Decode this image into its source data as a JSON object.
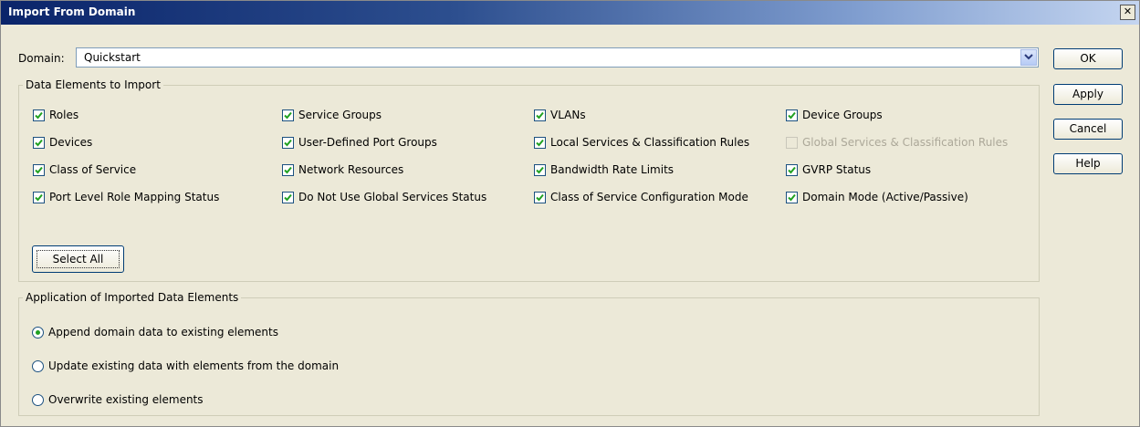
{
  "title": "Import From Domain",
  "close_glyph": "✕",
  "domain": {
    "label": "Domain:",
    "value": "Quickstart"
  },
  "buttons": {
    "ok": "OK",
    "apply": "Apply",
    "cancel": "Cancel",
    "help": "Help"
  },
  "data_elements": {
    "title": "Data Elements to Import",
    "items": [
      {
        "label": "Roles",
        "checked": true,
        "enabled": true
      },
      {
        "label": "Service Groups",
        "checked": true,
        "enabled": true
      },
      {
        "label": "VLANs",
        "checked": true,
        "enabled": true
      },
      {
        "label": "Device Groups",
        "checked": true,
        "enabled": true
      },
      {
        "label": "Devices",
        "checked": true,
        "enabled": true
      },
      {
        "label": "User-Defined Port Groups",
        "checked": true,
        "enabled": true
      },
      {
        "label": "Local Services & Classification Rules",
        "checked": true,
        "enabled": true
      },
      {
        "label": "Global Services & Classification Rules",
        "checked": false,
        "enabled": false
      },
      {
        "label": "Class of Service",
        "checked": true,
        "enabled": true
      },
      {
        "label": "Network Resources",
        "checked": true,
        "enabled": true
      },
      {
        "label": "Bandwidth Rate Limits",
        "checked": true,
        "enabled": true
      },
      {
        "label": "GVRP Status",
        "checked": true,
        "enabled": true
      },
      {
        "label": "Port Level Role Mapping Status",
        "checked": true,
        "enabled": true
      },
      {
        "label": "Do Not Use Global Services Status",
        "checked": true,
        "enabled": true
      },
      {
        "label": "Class of Service Configuration Mode",
        "checked": true,
        "enabled": true
      },
      {
        "label": "Domain Mode (Active/Passive)",
        "checked": true,
        "enabled": true
      }
    ],
    "select_all": "Select All"
  },
  "application": {
    "title": "Application of Imported Data Elements",
    "options": [
      {
        "label": "Append domain data to existing elements",
        "selected": true
      },
      {
        "label": "Update existing data with elements from the domain",
        "selected": false
      },
      {
        "label": "Overwrite existing elements",
        "selected": false
      }
    ]
  },
  "colors": {
    "title_bar_start": "#0a246a",
    "title_bar_end": "#c4d5f0",
    "check": "#21a121",
    "dialog_bg": "#ece9d8"
  }
}
